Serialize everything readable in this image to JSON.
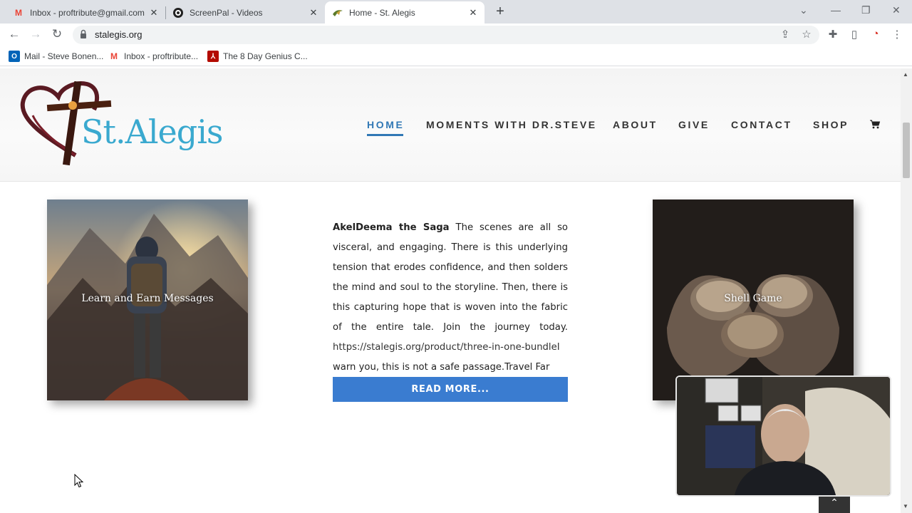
{
  "browser": {
    "tabs": [
      {
        "title": "Inbox - proftribute@gmail.com -",
        "icon": "gmail-icon"
      },
      {
        "title": "ScreenPal - Videos",
        "icon": "screenpal-icon"
      },
      {
        "title": "Home - St. Alegis",
        "icon": "st-alegis-icon"
      }
    ],
    "url": "stalegis.org",
    "bookmarks": [
      {
        "label": "Mail - Steve Bonen...",
        "icon": "outlook-icon",
        "color": "#0364b8"
      },
      {
        "label": "Inbox - proftribute...",
        "icon": "gmail-icon",
        "color": "#ea4335"
      },
      {
        "label": "The 8 Day Genius C...",
        "icon": "pdf-icon",
        "color": "#b30b00"
      }
    ]
  },
  "site": {
    "logo_text": "St.Alegis",
    "nav": [
      "HOME",
      "MOMENTS WITH DR.STEVE",
      "ABOUT",
      "GIVE",
      "CONTACT",
      "SHOP"
    ],
    "accent": "#3178b5",
    "button_color": "#3a7cd0"
  },
  "content": {
    "left_card_label": "Learn and Earn Messages",
    "right_card_label": "Shell Game",
    "title": "AkelDeema the Saga",
    "body": "The scenes are all so visceral, and engaging. There is this underlying tension that erodes confidence, and then solders the mind and soul to the storyline. Then, there is this capturing hope that is woven into the fabric of the entire tale. Join the journey today.",
    "link": "https://stalegis.org/product/three-in-one-bundleI",
    "tail": "warn you, this is not a safe passage.Travel Far",
    "read_more": "READ MORE..."
  }
}
